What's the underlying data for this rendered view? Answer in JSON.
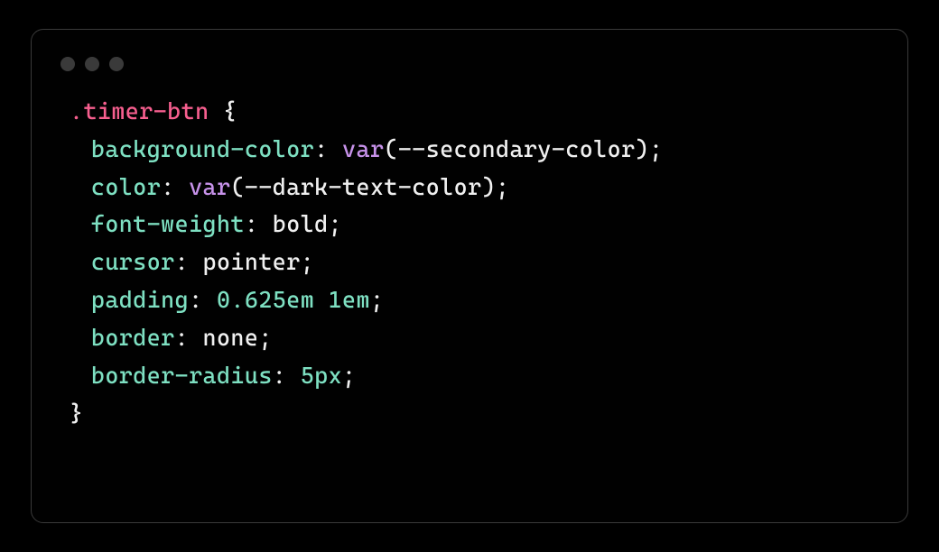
{
  "code": {
    "language": "css",
    "selector": ".timer-btn",
    "open_brace": "{",
    "close_brace": "}",
    "rules": [
      {
        "property": "background-color",
        "tokens": [
          {
            "type": "func",
            "text": "var"
          },
          {
            "type": "paren",
            "text": "("
          },
          {
            "type": "val",
            "text": "--secondary-color"
          },
          {
            "type": "paren",
            "text": ")"
          }
        ]
      },
      {
        "property": "color",
        "tokens": [
          {
            "type": "func",
            "text": "var"
          },
          {
            "type": "paren",
            "text": "("
          },
          {
            "type": "val",
            "text": "--dark-text-color"
          },
          {
            "type": "paren",
            "text": ")"
          }
        ]
      },
      {
        "property": "font-weight",
        "tokens": [
          {
            "type": "val",
            "text": "bold"
          }
        ]
      },
      {
        "property": "cursor",
        "tokens": [
          {
            "type": "val",
            "text": "pointer"
          }
        ]
      },
      {
        "property": "padding",
        "tokens": [
          {
            "type": "num",
            "text": "0.625em"
          },
          {
            "type": "val",
            "text": " "
          },
          {
            "type": "num",
            "text": "1em"
          }
        ]
      },
      {
        "property": "border",
        "tokens": [
          {
            "type": "val",
            "text": "none"
          }
        ]
      },
      {
        "property": "border-radius",
        "tokens": [
          {
            "type": "num",
            "text": "5px"
          }
        ]
      }
    ],
    "colon": ":",
    "semicolon": ";"
  }
}
